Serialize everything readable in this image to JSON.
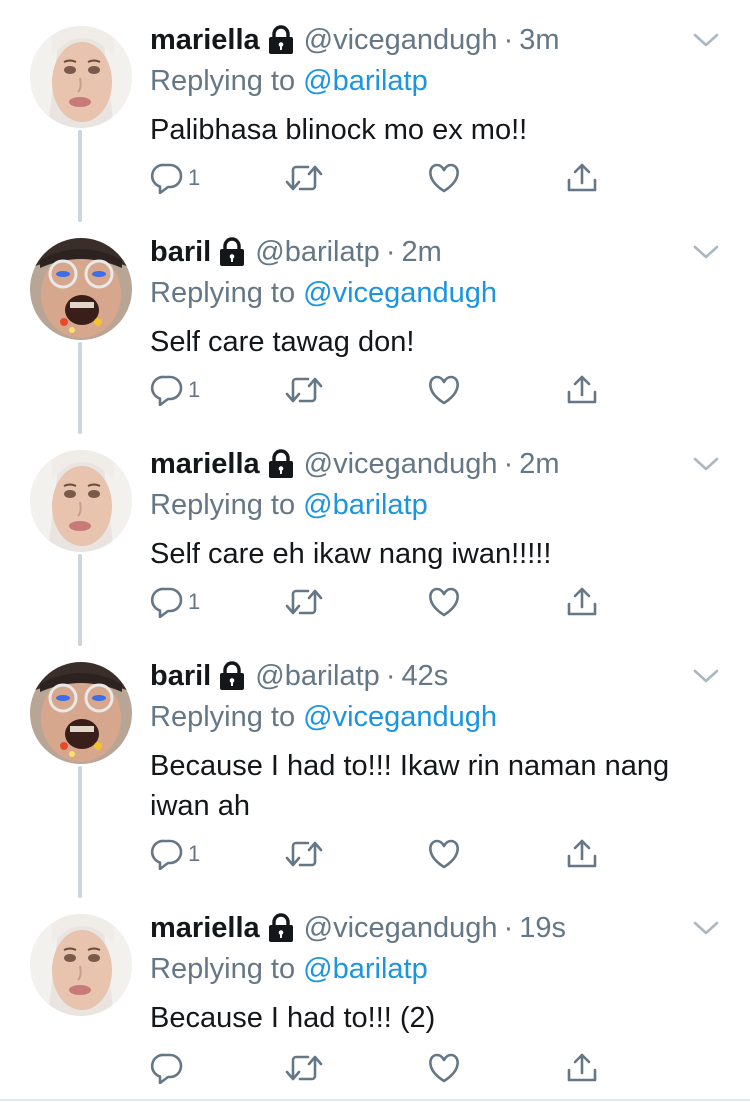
{
  "tweets": [
    {
      "author": "mariella",
      "handle": "@vicegandugh",
      "separator": "·",
      "time": "3m",
      "replying_prefix": "Replying to",
      "replying_to": "@barilatp",
      "text": "Palibhasa blinock mo ex mo!!",
      "reply_count": "1",
      "avatar": "mariella"
    },
    {
      "author": "baril",
      "handle": "@barilatp",
      "separator": "·",
      "time": "2m",
      "replying_prefix": "Replying to",
      "replying_to": "@vicegandugh",
      "text": "Self care tawag don!",
      "reply_count": "1",
      "avatar": "baril"
    },
    {
      "author": "mariella",
      "handle": "@vicegandugh",
      "separator": "·",
      "time": "2m",
      "replying_prefix": "Replying to",
      "replying_to": "@barilatp",
      "text": "Self care eh ikaw nang iwan!!!!!",
      "reply_count": "1",
      "avatar": "mariella"
    },
    {
      "author": "baril",
      "handle": "@barilatp",
      "separator": "·",
      "time": "42s",
      "replying_prefix": "Replying to",
      "replying_to": "@vicegandugh",
      "text": "Because I had to!!! Ikaw rin naman nang\niwan ah",
      "reply_count": "1",
      "avatar": "baril"
    },
    {
      "author": "mariella",
      "handle": "@vicegandugh",
      "separator": "·",
      "time": "19s",
      "replying_prefix": "Replying to",
      "replying_to": "@barilatp",
      "text": "Because I had to!!! (2)",
      "reply_count": "",
      "avatar": "mariella"
    }
  ],
  "icons": {
    "protected": "lock-icon",
    "menu": "chevron-down-icon",
    "reply": "reply-icon",
    "retweet": "retweet-icon",
    "like": "heart-icon",
    "share": "share-icon"
  },
  "colors": {
    "link": "#1b95e0",
    "secondary_text": "#657786",
    "thread_line": "#ccd6dd"
  }
}
